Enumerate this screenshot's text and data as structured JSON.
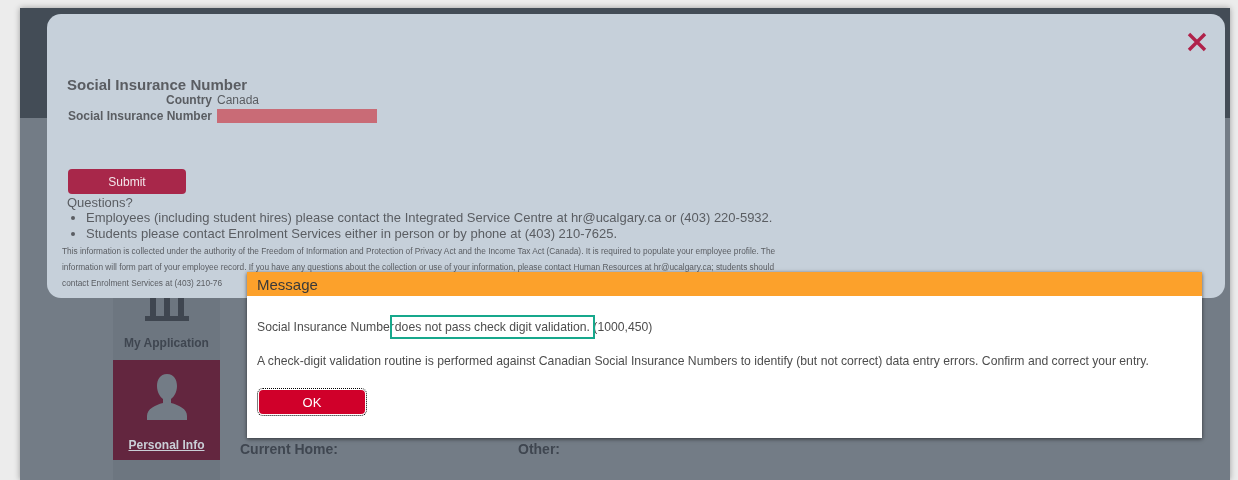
{
  "page": {
    "sidebar": {
      "items": [
        {
          "label": "My Application",
          "selected": false
        },
        {
          "label": "Personal Info",
          "selected": true
        }
      ]
    },
    "content": {
      "fields": [
        {
          "label": "Current Home:"
        },
        {
          "label": "Other:"
        }
      ]
    }
  },
  "form_dialog": {
    "title": "Social Insurance Number",
    "fields": [
      {
        "label": "Country",
        "kind": "text",
        "value": "Canada"
      },
      {
        "label": "Social Insurance Number",
        "kind": "redacted"
      }
    ],
    "submit": "Submit",
    "questions_heading": "Questions?",
    "questions": [
      "Employees (including student hires) please contact the Integrated Service Centre at hr@ucalgary.ca or (403) 220-5932.",
      "Students please contact Enrolment Services either in person or by phone at (403) 210-7625."
    ],
    "notice_lines": [
      "This information is collected under the authority of the Freedom of Information and Protection of Privacy Act and the Income Tax Act (Canada). It is required to populate your employee profile. The",
      "information will form part of your employee record. If you have any questions about the collection or use of your information, please contact Human Resources at hr@ucalgary.ca; students should",
      "contact Enrolment Services at (403) 210-76"
    ]
  },
  "message_dialog": {
    "title": "Message",
    "message": {
      "before": "Social Insurance Number",
      "highlighted": "does not pass check digit validation.",
      "after": "(1000,450)"
    },
    "note": "A check-digit validation routine is performed against Canadian Social Insurance Numbers to identify (but not correct) data entry errors.  Confirm and correct your entry.",
    "ok": "OK"
  }
}
